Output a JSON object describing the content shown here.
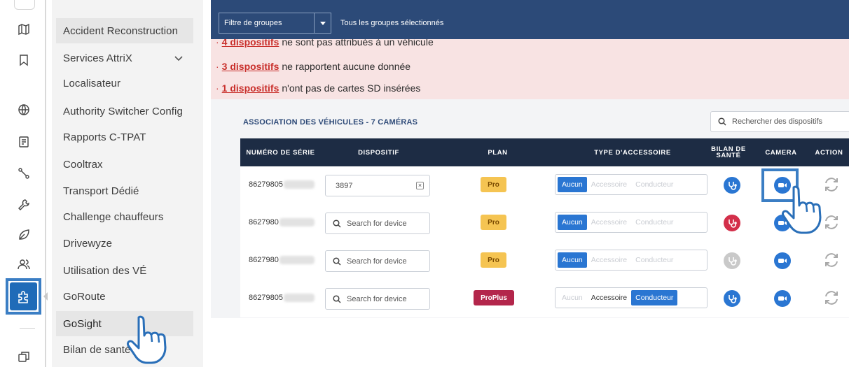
{
  "menu": {
    "items": [
      {
        "label": "Accident Reconstruction"
      },
      {
        "label": "Services AttriX"
      },
      {
        "label": "Localisateur"
      },
      {
        "label": "Authority Switcher Config"
      },
      {
        "label": "Rapports C-TPAT"
      },
      {
        "label": "Cooltrax"
      },
      {
        "label": "Transport Dédié"
      },
      {
        "label": "Challenge chauffeurs"
      },
      {
        "label": "Drivewyze"
      },
      {
        "label": "Utilisation des VÉ"
      },
      {
        "label": "GoRoute"
      },
      {
        "label": "GoSight"
      },
      {
        "label": "Bilan de santé"
      }
    ]
  },
  "rail": {
    "icons": [
      "map-icon",
      "bookmark-icon",
      "globe-icon",
      "document-icon",
      "route-icon",
      "wrench-icon",
      "leaf-icon",
      "users-icon",
      "puzzle-icon",
      "windows-icon"
    ]
  },
  "topbar": {
    "filter_label": "Filtre de groupes",
    "filter_status": "Tous les groupes sélectionnés"
  },
  "alerts": [
    {
      "link": "4 dispositifs",
      "text": "ne sont pas attribués à un véhicule"
    },
    {
      "link": "3 dispositifs",
      "text": "ne rapportent aucune donnée"
    },
    {
      "link": "1 dispositifs",
      "text": "n'ont pas de cartes SD insérées"
    }
  ],
  "section": {
    "title": "ASSOCIATION DES VÉHICULES - 7 CAMÉRAS",
    "search_placeholder": "Rechercher des dispositifs"
  },
  "table": {
    "headers": {
      "serial": "NUMÉRO DE SÉRIE",
      "device": "DISPOSITIF",
      "plan": "PLAN",
      "accessory": "TYPE D'ACCESSOIRE",
      "health_1": "BILAN DE",
      "health_2": "SANTÉ",
      "camera": "CAMERA",
      "action": "ACTION"
    },
    "rows": [
      {
        "serial": "86279805",
        "device_value": "3897",
        "plan": "Pro",
        "acc": [
          "Aucun",
          "Accessoire",
          "Conducteur"
        ],
        "selected": "Aucun",
        "health": "good"
      },
      {
        "serial": "8627980",
        "device_placeholder": "Search for device",
        "plan": "Pro",
        "acc": [
          "Aucun",
          "Accessoire",
          "Conducteur"
        ],
        "selected": "Aucun",
        "health": "bad"
      },
      {
        "serial": "8627980",
        "device_placeholder": "Search for device",
        "plan": "Pro",
        "acc": [
          "Aucun",
          "Accessoire",
          "Conducteur"
        ],
        "selected": "Aucun",
        "health": "unknown"
      },
      {
        "serial": "86279805",
        "device_placeholder": "Search for device",
        "plan": "ProPlus",
        "acc": [
          "Aucun",
          "Accessoire",
          "Conducteur"
        ],
        "selected": "Conducteur",
        "health": "good"
      }
    ]
  },
  "colors": {
    "topbar": "#2c4a78",
    "alert_bg": "#f8e3e3",
    "header_bg": "#1d2c44",
    "accent": "#2a76d2",
    "highlight": "#3b7ec4",
    "pro": "#f5c452",
    "proplus": "#b3264b",
    "health_bad": "#d32f4a",
    "health_unknown": "#c9c9c9"
  }
}
